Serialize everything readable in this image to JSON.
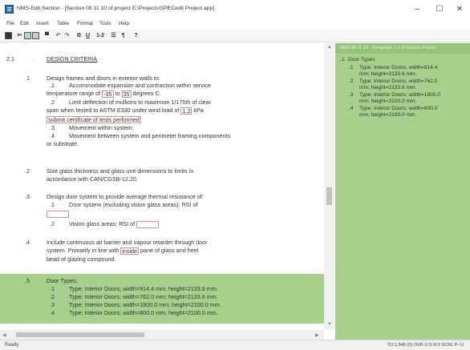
{
  "window": {
    "title": "NMS-Edit Section - [Section 08 11 10 of project E:\\Projects\\SPECedit Project.app]",
    "minimize": "–",
    "maximize": "☐",
    "close": "✕"
  },
  "menu": [
    "File",
    "Edit",
    "Insert",
    "Table",
    "Format",
    "Tools",
    "Help"
  ],
  "toolbar": {
    "bold": "B",
    "underline": "U",
    "numbering": "1-2",
    "help": "?"
  },
  "editor": {
    "section_num": "2.1",
    "heading": "DESIGN CRITERIA",
    "p1": {
      "num": ".1",
      "l1": "Design frames and doors in exterior walls to:",
      "s1_num": ".1",
      "s1_l1": "Accommodate expansion and contraction within service",
      "s1_l2a": "temperature range of",
      "s1_v1": "-35",
      "s1_l2b": "to",
      "s1_v2": "35",
      "s1_l2c": "degrees C.",
      "s2_num": ".2",
      "s2_l1": "Limit deflection of mullions to maximum 1/175th of clear",
      "s2_l2a": "span when tested to ASTM E330 under wind load of",
      "s2_v1": "1.2",
      "s2_l2b": "kPa",
      "s2_l3": "submit certificate of tests performed",
      "s3_num": ".3",
      "s3_l1": "Movement within system.",
      "s4_num": ".4",
      "s4_l1": "Movement between system and perimeter framing components",
      "s4_l2": "or substrate."
    },
    "p2": {
      "num": ".2",
      "l1": "Size glass thickness and glass unit dimensions to limits in",
      "l2": "accordance with CAN/CGSB-12.20."
    },
    "p3": {
      "num": ".3",
      "l1": "Design door system to provide average thermal resistance of:",
      "s1_num": ".1",
      "s1_l1": "Door system (excluding vision glass areas): RSI of",
      "s2_num": ".2",
      "s2_l1": "Vision glass areas: RSI of"
    },
    "p4": {
      "num": ".4",
      "l1": "Include continuous air barrier and vapour retarder through door",
      "l2a": "system. Primarily in line with",
      "l2v": "inside",
      "l2b": "pane of glass and heel",
      "l3": "bead of glazing compound."
    },
    "p5": {
      "num": ".5",
      "l1": "Door Types:",
      "items": [
        {
          "num": ".1",
          "text": "Type: Interior Doors; width=914.4 mm; height=2133.6 mm."
        },
        {
          "num": ".2",
          "text": "Type: Interior Doors; width=762.0 mm; height=2133.6 mm."
        },
        {
          "num": ".3",
          "text": "Type: Interior Doors; width=1800.0 mm; height=2100.0 mm."
        },
        {
          "num": ".4",
          "text": "Type: Interior Doors; width=800.0 mm; height=2100.0 mm."
        }
      ]
    }
  },
  "side_panel": {
    "header": "NMS 08 11 10 - Paragraph 2.1 of Section  Project",
    "title_num": ".1",
    "title": "Door Types",
    "lines": [
      {
        "num": ".1",
        "text": "Type: Interior Doors; width=914.4"
      },
      {
        "num": "",
        "text": "mm; height=2133.6 mm."
      },
      {
        "num": ".2",
        "text": "Type: Interior Doors; width=762.0"
      },
      {
        "num": "",
        "text": "mm; height=2133.6 mm."
      },
      {
        "num": ".3",
        "text": "Type: Interior Doors; width=1800.0"
      },
      {
        "num": "",
        "text": "mm; height=2100.0 mm."
      },
      {
        "num": ".4",
        "text": "Type: Interior Doors; width=800.0"
      },
      {
        "num": "",
        "text": "mm; height=2100.0 mm."
      }
    ]
  },
  "status": {
    "left": "Ready",
    "right": "TO:1,548 (0)  OVR  U:S  R:0  SCRL P- U"
  },
  "colors": {
    "highlight": "#a8d08d",
    "field_border": "#e58b8b"
  }
}
